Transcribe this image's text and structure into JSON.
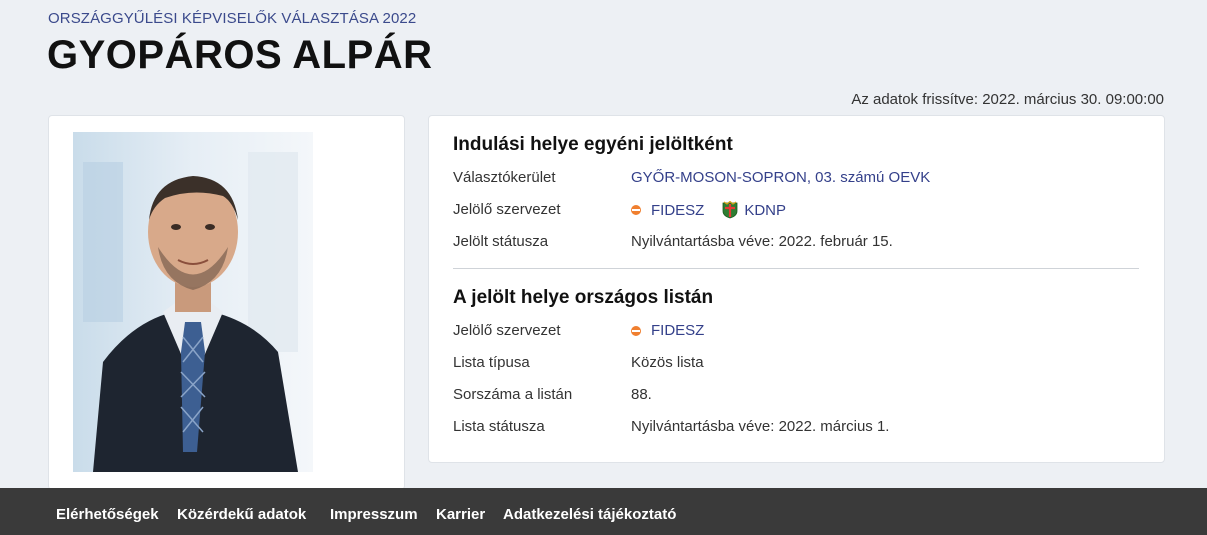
{
  "header": {
    "subtitle": "ORSZÁGGYŰLÉSI KÉPVISELŐK VÁLASZTÁSA 2022",
    "name": "GYOPÁROS ALPÁR",
    "updated": "Az adatok frissítve: 2022. március 30. 09:00:00"
  },
  "photo": {
    "alt": "Gyopáros Alpár portré"
  },
  "individual": {
    "title": "Indulási helye egyéni jelöltként",
    "district_label": "Választókerület",
    "district_value": "GYŐR-MOSON-SOPRON, 03. számú OEVK",
    "org_label": "Jelölő szervezet",
    "org_values": [
      "FIDESZ",
      "KDNP"
    ],
    "status_label": "Jelölt státusza",
    "status_value": "Nyilvántartásba véve: 2022. február 15."
  },
  "national_list": {
    "title": "A jelölt helye országos listán",
    "org_label": "Jelölő szervezet",
    "org_value": "FIDESZ",
    "type_label": "Lista típusa",
    "type_value": "Közös lista",
    "rank_label": "Sorszáma a listán",
    "rank_value": "88.",
    "status_label": "Lista státusza",
    "status_value": "Nyilvántartásba véve: 2022. március 1."
  },
  "icons": {
    "fidesz": "fidesz-logo-icon",
    "kdnp": "kdnp-logo-icon"
  },
  "colors": {
    "accent": "#34408a",
    "fidesz_orange": "#f07f2f",
    "footer_bg": "#3a3a3a",
    "page_bg": "#edf0f4"
  },
  "footer": {
    "links": [
      "Elérhetőségek",
      "Közérdekű adatok",
      "Impresszum",
      "Karrier",
      "Adatkezelési tájékoztató"
    ]
  }
}
